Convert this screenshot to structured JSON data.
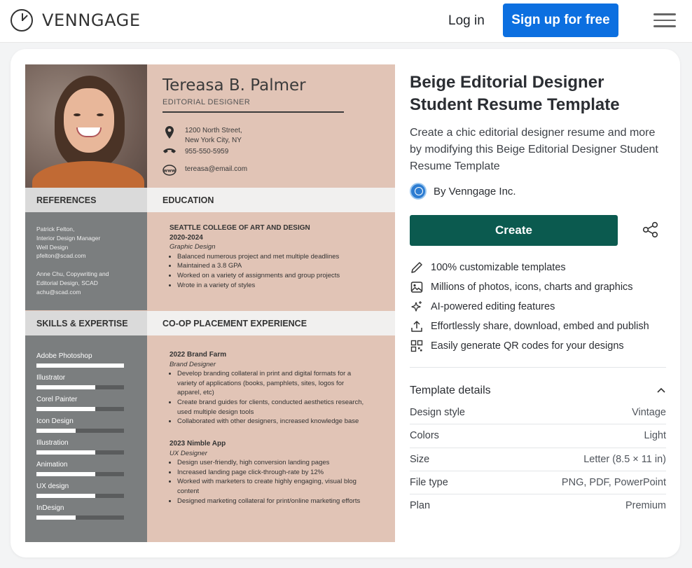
{
  "header": {
    "brand": "VENNGAGE",
    "login_label": "Log in",
    "signup_label": "Sign up for free"
  },
  "resume": {
    "name": "Tereasa B. Palmer",
    "role": "EDITORIAL DESIGNER",
    "address_line1": "1200 North Street,",
    "address_line2": "New York City, NY",
    "phone": "955-550-5959",
    "email": "tereasa@email.com",
    "references_heading": "REFERENCES",
    "references": [
      [
        "Patrick Felton,",
        "Interior Design Manager",
        "Well Design",
        "pfelton@scad.com"
      ],
      [
        "Anne Chu, Copywriting and",
        "Editorial Design, SCAD",
        "achu@scad.com"
      ]
    ],
    "education_heading": "EDUCATION",
    "education": {
      "school": "SEATTLE COLLEGE OF ART AND DESIGN",
      "years": "2020-2024",
      "program": "Graphic Design",
      "bullets": [
        "Balanced numerous project and met multiple deadlines",
        "Maintained a 3.8 GPA",
        "Worked on a variety of assignments and group projects",
        "Wrote in a variety of styles"
      ]
    },
    "skills_heading": "SKILLS & EXPERTISE",
    "skills": [
      {
        "name": "Adobe Photoshop",
        "level": 1.0
      },
      {
        "name": "Illustrator",
        "level": 0.67
      },
      {
        "name": "Corel Painter",
        "level": 0.67
      },
      {
        "name": "Icon Design",
        "level": 0.45
      },
      {
        "name": "Illustration",
        "level": 0.67
      },
      {
        "name": "Animation",
        "level": 0.67
      },
      {
        "name": "UX design",
        "level": 0.67
      },
      {
        "name": "InDesign",
        "level": 0.45
      }
    ],
    "coop_heading": "CO-OP PLACEMENT EXPERIENCE",
    "jobs": [
      {
        "title": "2022 Brand Farm",
        "role": "Brand Designer",
        "bullets": [
          [
            "Develop branding collateral in print and digital formats for a",
            "variety of applications (books, pamphlets, sites, logos for",
            "apparel, etc)"
          ],
          [
            "Create brand guides for clients, conducted aesthetics research,",
            "used multiple design tools"
          ],
          [
            "Collaborated with other designers, increased knowledge base"
          ]
        ]
      },
      {
        "title": "2023 Nimble App",
        "role": "UX Designer",
        "bullets": [
          [
            "Design user-friendly, high conversion landing pages"
          ],
          [
            "Increased landing page click-through-rate by 12%"
          ],
          [
            "Worked with marketers to create highly engaging, visual blog",
            "content"
          ],
          [
            "Designed marketing collateral for print/online marketing efforts"
          ]
        ]
      }
    ]
  },
  "template": {
    "title": "Beige Editorial Designer Student Resume Template",
    "description": "Create a chic editorial designer resume and more by modifying this Beige Editorial Designer Student Resume Template",
    "author": "By Venngage Inc.",
    "create_label": "Create"
  },
  "features": [
    {
      "icon": "pencil-icon",
      "text": "100% customizable templates"
    },
    {
      "icon": "image-icon",
      "text": "Millions of photos, icons, charts and graphics"
    },
    {
      "icon": "sparkle-icon",
      "text": "AI-powered editing features"
    },
    {
      "icon": "upload-icon",
      "text": "Effortlessly share, download, embed and publish"
    },
    {
      "icon": "qr-code-icon",
      "text": "Easily generate QR codes for your designs"
    }
  ],
  "details": {
    "heading": "Template details",
    "rows": [
      {
        "label": "Design style",
        "value": "Vintage"
      },
      {
        "label": "Colors",
        "value": "Light"
      },
      {
        "label": "Size",
        "value": "Letter (8.5 × 11 in)"
      },
      {
        "label": "File type",
        "value": "PNG, PDF, PowerPoint"
      },
      {
        "label": "Plan",
        "value": "Premium"
      }
    ]
  },
  "colors": {
    "signup_blue": "#0c6fe0",
    "create_green": "#0b5a4f",
    "resume_beige": "#e1c4b6",
    "resume_grey": "#7b7e7f"
  }
}
